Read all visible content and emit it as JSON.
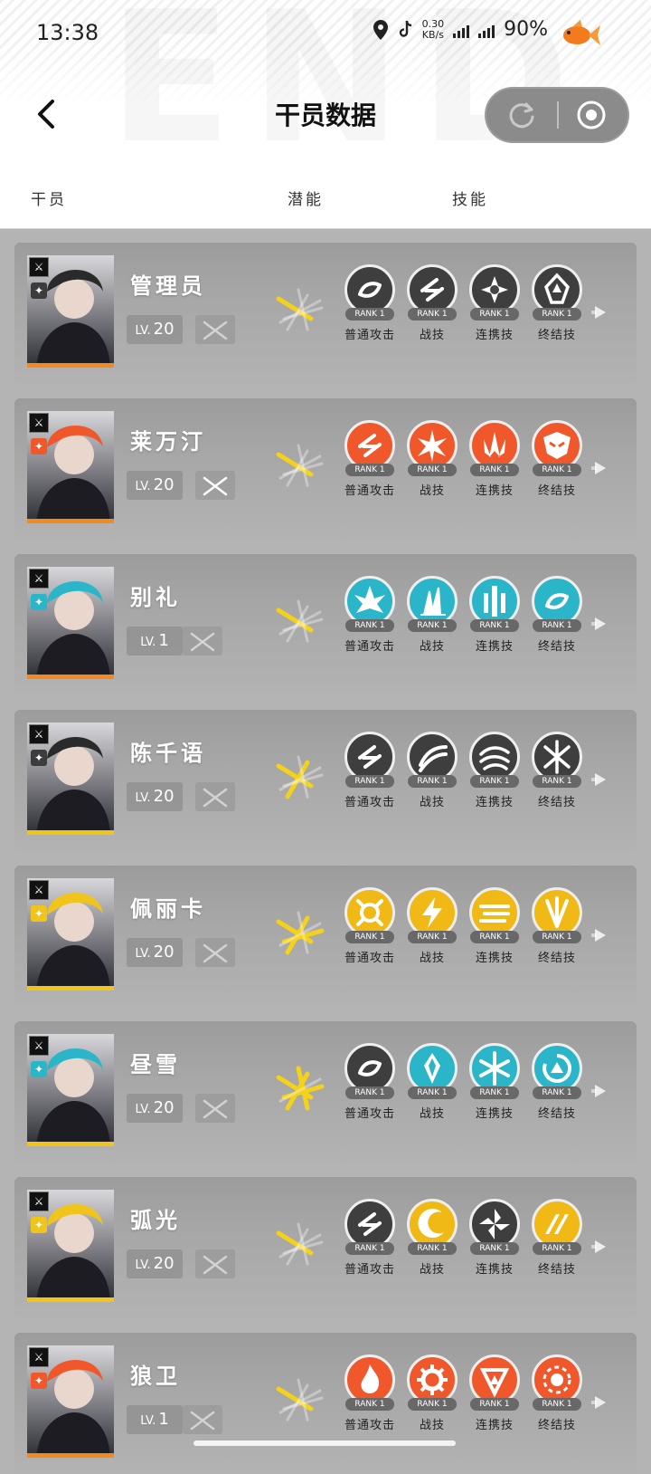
{
  "status_bar": {
    "time": "13:38",
    "net_speed_value": "0.30",
    "net_speed_unit": "KB/s",
    "battery": "90%"
  },
  "header": {
    "title": "干员数据",
    "columns": {
      "operator": "干员",
      "potential": "潜能",
      "skills": "技能"
    }
  },
  "skill_labels": [
    "普通攻击",
    "战技",
    "连携技",
    "终结技"
  ],
  "rank_label": "RANK 1",
  "level_prefix": "LV.",
  "operators": [
    {
      "name": "管理员",
      "level": "20",
      "element_color": "#3c3c3c",
      "bar_color": "#f28a1f",
      "weapon_state": "dim",
      "potential": 1,
      "skill_fill": [
        "#3e3e3e",
        "#3e3e3e",
        "#3e3e3e",
        "#3e3e3e"
      ],
      "skill_icons": [
        "swirl-icon",
        "slash-icon",
        "burst-icon",
        "crown-icon"
      ]
    },
    {
      "name": "莱万汀",
      "level": "20",
      "element_color": "#f0582b",
      "bar_color": "#f28a1f",
      "weapon_state": "lit",
      "potential": 1,
      "skill_fill": [
        "#f0582b",
        "#f0582b",
        "#f0582b",
        "#f0582b"
      ],
      "skill_icons": [
        "slash-icon",
        "star-burst-icon",
        "spike-icon",
        "mask-icon"
      ]
    },
    {
      "name": "别礼",
      "level": "1",
      "element_color": "#2bb5c8",
      "bar_color": "#f28a1f",
      "weapon_state": "dim",
      "potential": 1,
      "skill_fill": [
        "#2bb5c8",
        "#2bb5c8",
        "#2bb5c8",
        "#2bb5c8"
      ],
      "skill_icons": [
        "crystal-icon",
        "shard-icon",
        "pillar-icon",
        "swirl-icon"
      ]
    },
    {
      "name": "陈千语",
      "level": "20",
      "element_color": "#3c3c3c",
      "bar_color": "#f0c419",
      "weapon_state": "dim",
      "potential": 2,
      "skill_fill": [
        "#3e3e3e",
        "#3e3e3e",
        "#3e3e3e",
        "#3e3e3e"
      ],
      "skill_icons": [
        "slash-icon",
        "wave-icon",
        "wind-icon",
        "cross-icon"
      ]
    },
    {
      "name": "佩丽卡",
      "level": "20",
      "element_color": "#f0c419",
      "bar_color": "#f0c419",
      "weapon_state": "dim",
      "potential": 3,
      "skill_fill": [
        "#f0b915",
        "#f0b915",
        "#f0b915",
        "#f0b915"
      ],
      "skill_icons": [
        "ring-icon",
        "bolt-icon",
        "lines-icon",
        "fan-icon"
      ]
    },
    {
      "name": "昼雪",
      "level": "20",
      "element_color": "#2bb5c8",
      "bar_color": "#f0c419",
      "weapon_state": "dim",
      "potential": 4,
      "skill_fill": [
        "#3e3e3e",
        "#2bb5c8",
        "#2bb5c8",
        "#2bb5c8"
      ],
      "skill_icons": [
        "swirl-icon",
        "ice-icon",
        "snowflake-icon",
        "cycle-icon"
      ]
    },
    {
      "name": "弧光",
      "level": "20",
      "element_color": "#f0c419",
      "bar_color": "#f0c419",
      "weapon_state": "dim",
      "potential": 1,
      "skill_fill": [
        "#3e3e3e",
        "#f0b915",
        "#3e3e3e",
        "#f0b915"
      ],
      "skill_icons": [
        "slash-icon",
        "crescent-icon",
        "pinwheel-icon",
        "stripes-icon"
      ]
    },
    {
      "name": "狼卫",
      "level": "1",
      "element_color": "#f0582b",
      "bar_color": "#f28a1f",
      "weapon_state": "dim",
      "potential": 1,
      "skill_fill": [
        "#f0582b",
        "#f0582b",
        "#f0582b",
        "#f0582b"
      ],
      "skill_icons": [
        "flame-icon",
        "gear-icon",
        "triangle-icon",
        "sun-icon"
      ]
    }
  ]
}
